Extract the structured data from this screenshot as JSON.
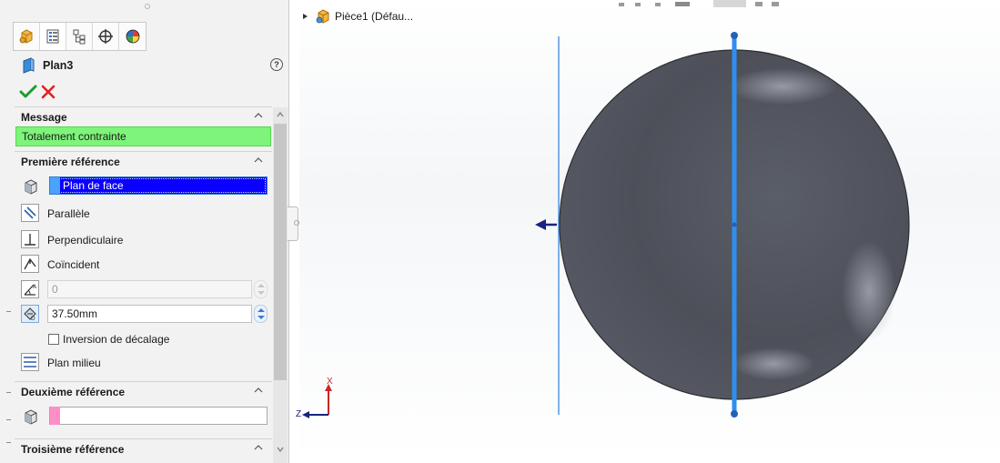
{
  "panel": {
    "tabs": [
      {
        "name": "feature-manager-tab",
        "icon": "part-icon"
      },
      {
        "name": "property-manager-tab",
        "icon": "property-icon"
      },
      {
        "name": "configuration-manager-tab",
        "icon": "configuration-icon"
      },
      {
        "name": "dimxpert-tab",
        "icon": "crosshair-icon"
      },
      {
        "name": "display-manager-tab",
        "icon": "appearance-icon"
      }
    ],
    "feature_title": "Plan3",
    "message_section": {
      "title": "Message",
      "status_text": "Totalement contrainte",
      "status_color": "#7ef47a"
    },
    "first_reference": {
      "title": "Première référence",
      "selection": "Plan de face",
      "options": {
        "parallel": "Parallèle",
        "perpendicular": "Perpendiculaire",
        "coincident": "Coïncident"
      },
      "angle_value": "0",
      "offset_value": "37.50mm",
      "flip_offset_label": "Inversion de décalage",
      "mid_plane_label": "Plan milieu"
    },
    "second_reference": {
      "title": "Deuxième référence",
      "selection": "",
      "marker_color": "#ff8ec8"
    },
    "third_reference": {
      "title": "Troisième référence"
    }
  },
  "viewport": {
    "tree_root_label": "Pièce1  (Défau...",
    "triad": {
      "x_label": "X",
      "z_label": "Z"
    },
    "colors": {
      "sphere": "#4d5059",
      "plane_preview": "#2f8ff0",
      "plane_edge": "#2e7fd8",
      "arrow": "#1a237e"
    }
  }
}
